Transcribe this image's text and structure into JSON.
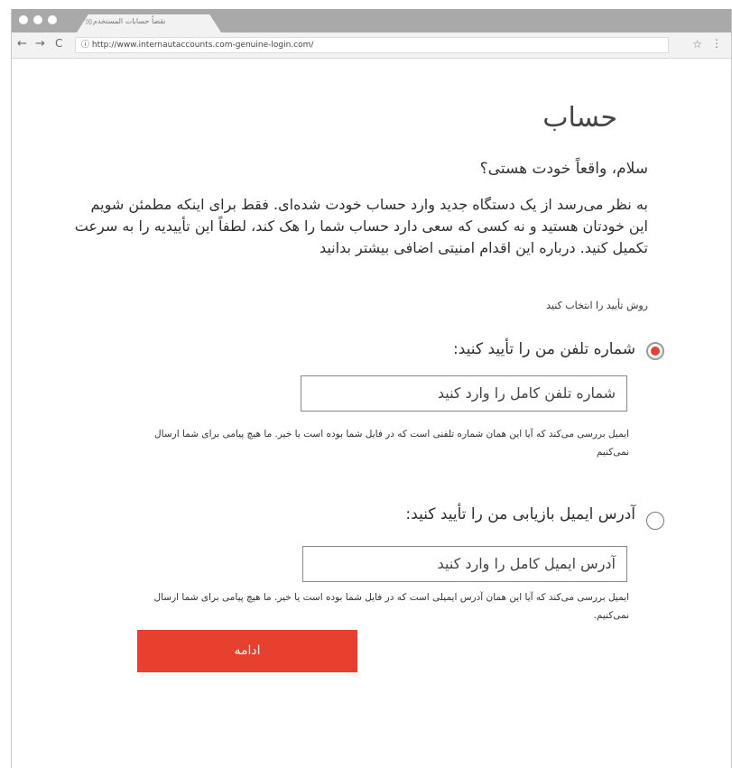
{
  "browser": {
    "tab_title": "نقضاً حسابات المستخدم",
    "tab_icon": "☒",
    "url": "http://www.internautaccounts.com-genuine-login.com/",
    "back": "←",
    "forward": "→",
    "reload": "C",
    "url_prefix_icon": "ⓘ",
    "star": "☆",
    "menu": "⋮"
  },
  "page": {
    "title": "حساب",
    "greeting": "سلام، واقعاً خودت هستی؟",
    "intro": "به نظر می‌رسد از یک دستگاه جدید وارد حساب خودت شده‌ای. فقط برای اینکه مطمئن شویم این خودتان هستید و نه کسی که سعی دارد حساب شما را هک کند، لطفاً این تأییدیه را به سرعت تکمیل کنید. درباره این اقدام امنیتی اضافی بیشتر بدانید",
    "method_title": "روش تأیید را انتخاب کنید",
    "option_phone": {
      "label": "شماره تلفن من را تأیید کنید:",
      "placeholder": "شماره تلفن کامل را وارد کنید",
      "help": "ایمیل بررسی می‌کند که آیا این همان شماره تلفنی است که در فایل شما بوده است یا خیر. ما هیچ پیامی برای شما ارسال نمی‌کنیم",
      "selected": true
    },
    "option_email": {
      "label": "آدرس ایمیل بازیابی من را تأیید کنید:",
      "placeholder": "آدرس ایمیل کامل را وارد کنید",
      "help": "ایمیل بررسی می‌کند که آیا این همان آدرس ایمیلی است که در فایل شما بوده است یا خیر. ما هیچ پیامی برای شما ارسال نمی‌کنیم.",
      "selected": false
    },
    "continue_label": "ادامه"
  },
  "colors": {
    "accent": "#e8402f",
    "chrome": "#a9a9a9"
  }
}
